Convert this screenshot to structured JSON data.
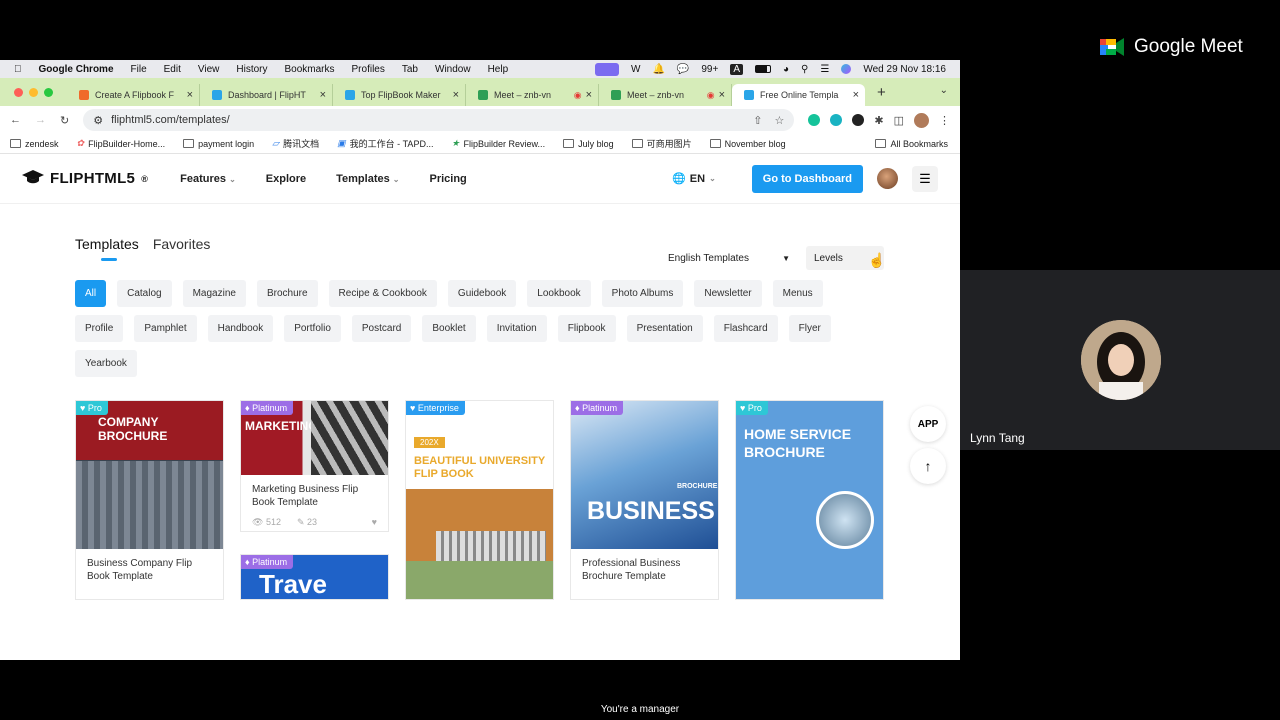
{
  "meet": {
    "title": "Google Meet",
    "participant_name": "Lynn Tang",
    "manager_text": "You're a manager"
  },
  "macos": {
    "menu": [
      "Google Chrome",
      "File",
      "Edit",
      "View",
      "History",
      "Bookmarks",
      "Profiles",
      "Tab",
      "Window",
      "Help"
    ],
    "notif_count": "99+",
    "clock": "Wed 29 Nov  18:16"
  },
  "tabs": [
    {
      "title": "Create A Flipbook F",
      "color": "#f06a2a"
    },
    {
      "title": "Dashboard | FlipHT",
      "color": "#2aa5e8"
    },
    {
      "title": "Top FlipBook Maker",
      "color": "#2aa5e8"
    },
    {
      "title": "Meet – znb-vn",
      "color": "#2e9f55"
    },
    {
      "title": "Meet – znb-vn",
      "color": "#2e9f55"
    },
    {
      "title": "Free Online Templa",
      "color": "#2aa5e8"
    }
  ],
  "address": {
    "url": "fliphtml5.com/templates/"
  },
  "bookmarks": [
    "zendesk",
    "FlipBuilder-Home...",
    "payment login",
    "腾讯文档",
    "我的工作台 - TAPD...",
    "FlipBuilder Review...",
    "July blog",
    "可商用图片",
    "November blog"
  ],
  "all_bookmarks": "All Bookmarks",
  "site": {
    "logo": "FLIPHTML5",
    "logo_sup": "®",
    "nav": {
      "features": "Features",
      "explore": "Explore",
      "templates": "Templates",
      "pricing": "Pricing"
    },
    "lang": "EN",
    "dashboard": "Go to Dashboard",
    "tabs": {
      "templates": "Templates",
      "favorites": "Favorites"
    },
    "filter_lang": "English Templates",
    "filter_levels": "Levels",
    "chips": [
      "All",
      "Catalog",
      "Magazine",
      "Brochure",
      "Recipe & Cookbook",
      "Guidebook",
      "Lookbook",
      "Photo Albums",
      "Newsletter",
      "Menus",
      "Profile",
      "Pamphlet",
      "Handbook",
      "Portfolio",
      "Postcard",
      "Booklet",
      "Invitation",
      "Flipbook",
      "Presentation",
      "Flashcard",
      "Flyer",
      "Yearbook"
    ],
    "app": "APP",
    "cards": [
      {
        "badge": "Pro",
        "badge_color": "#2ec7d6",
        "title": "Business Company Flip Book Template",
        "cover_text": "COMPANY BROCHURE",
        "views": "",
        "likes": ""
      },
      {
        "badge": "Platinum",
        "badge_color": "#9c6ee6",
        "title": "Marketing Business Flip Book Template",
        "cover_text": "MARKETING",
        "views": "512",
        "likes": "23"
      },
      {
        "badge": "Enterprise",
        "badge_color": "#2a9cf0",
        "title": "",
        "cover_text": "BEAUTIFUL UNIVERSITY FLIP BOOK",
        "cover_year": "202X",
        "views": "",
        "likes": ""
      },
      {
        "badge": "Platinum",
        "badge_color": "#9c6ee6",
        "title": "Professional Business Brochure Template",
        "cover_text": "BUSINESS",
        "cover_small": "BROCHURE",
        "views": "",
        "likes": ""
      },
      {
        "badge": "Pro",
        "badge_color": "#2ec7d6",
        "title": "",
        "cover_text": "HOME SERVICE BROCHURE",
        "views": "",
        "likes": ""
      },
      {
        "badge": "Platinum",
        "badge_color": "#9c6ee6",
        "title": "",
        "cover_text": "Trave",
        "views": "",
        "likes": ""
      }
    ]
  }
}
